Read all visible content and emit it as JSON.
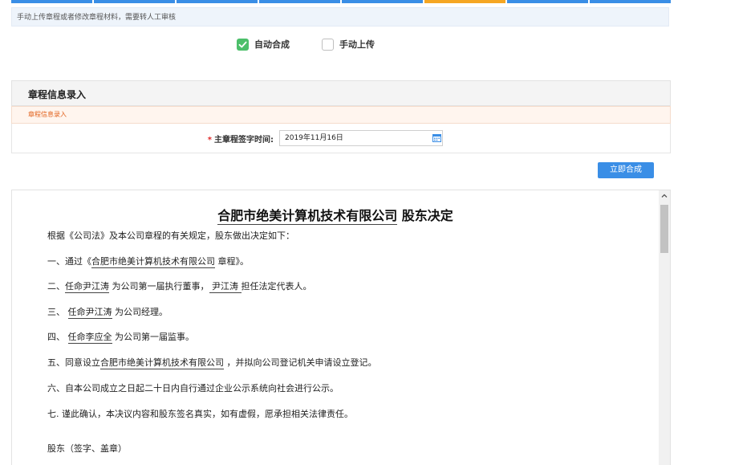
{
  "colors": {
    "step_bar": [
      "#3a8ee6",
      "#3a8ee6",
      "#3a8ee6",
      "#3a8ee6",
      "#3a8ee6",
      "#f5a623",
      "#3a8ee6",
      "#3a8ee6"
    ],
    "accent": "#3a8ee6",
    "checked": "#4cbf6a",
    "required": "#e02a2a",
    "subtitle": "#e2611c"
  },
  "hint": "手动上传章程或者修改章程材料，需要转人工审核",
  "mode": {
    "auto_label": "自动合成",
    "manual_label": "手动上传",
    "auto_checked": true,
    "manual_checked": false
  },
  "panel": {
    "title": "章程信息录入",
    "subtitle": "章程信息录入"
  },
  "form": {
    "required_mark": "*",
    "sign_date_label": "主章程签字时间:",
    "sign_date_value": "2019年11月16日",
    "calendar_icon": "calendar-icon"
  },
  "compose_button": "立即合成",
  "document": {
    "title_company": "合肥市绝美计算机技术有限公司",
    "title_suffix": " 股东决定",
    "intro": "根据《公司法》及本公司章程的有关规定，股东做出决定如下：",
    "l1_a": "一、通过《",
    "l1_b": "合肥市绝美计算机技术有限公司",
    "l1_c": " 章程》。",
    "l2_a": "二、",
    "l2_b": "任命尹江涛",
    "l2_c": " 为公司第一届执行董事，",
    "l2_d": " 尹江涛 ",
    "l2_e": "担任法定代表人。",
    "l3_a": "三、 ",
    "l3_b": "任命尹江涛",
    "l3_c": " 为公司经理。",
    "l4_a": "四、 ",
    "l4_b": "任命李应全",
    "l4_c": " 为公司第一届监事。",
    "l5_a": "五、同意设立",
    "l5_b": "合肥市绝美计算机技术有限公司",
    "l5_c": " ，并拟向公司登记机关申请设立登记。",
    "l6": "六、自本公司成立之日起二十日内自行通过企业公示系统向社会进行公示。",
    "l7": "七. 谨此确认，本决议内容和股东签名真实，如有虚假，愿承担相关法律责任。",
    "sign": "股东（签字、盖章）"
  }
}
